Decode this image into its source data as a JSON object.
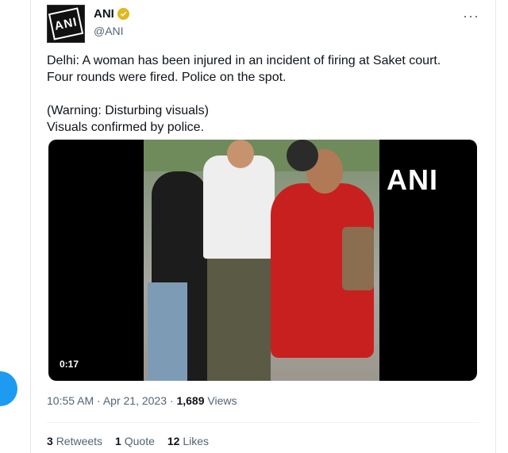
{
  "author": {
    "name": "ANI",
    "handle": "@ANI",
    "avatar_text": "ANI"
  },
  "tweet": {
    "line1": "Delhi: A woman has been injured in an incident of firing at Saket court.",
    "line2": "Four rounds were fired. Police on the spot.",
    "line3": "(Warning: Disturbing visuals)",
    "line4": "Visuals confirmed by police."
  },
  "media": {
    "watermark": "ANI",
    "duration": "0:17"
  },
  "meta": {
    "time": "10:55 AM",
    "separator": " · ",
    "date": "Apr 21, 2023",
    "views_count": "1,689",
    "views_label": "Views"
  },
  "stats": {
    "retweets_count": "3",
    "retweets_label": "Retweets",
    "quotes_count": "1",
    "quotes_label": "Quote",
    "likes_count": "12",
    "likes_label": "Likes"
  },
  "colors": {
    "accent": "#1d9bf0",
    "verified": "#e2b719",
    "secondary_text": "#536471"
  },
  "icons": [
    "verified-badge-icon",
    "more-options-icon"
  ]
}
